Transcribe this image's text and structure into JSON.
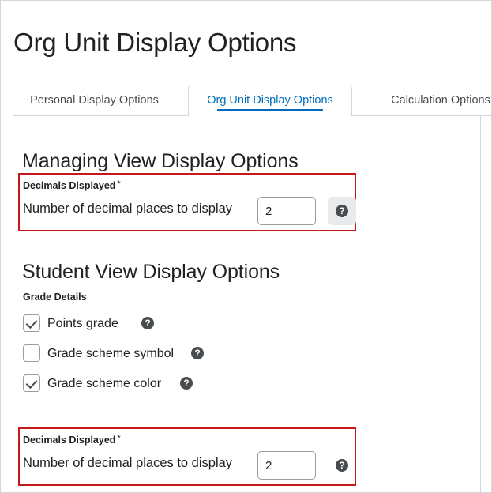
{
  "page": {
    "title": "Org Unit Display Options"
  },
  "tabs": [
    {
      "label": "Personal Display Options",
      "active": false
    },
    {
      "label": "Org Unit Display Options",
      "active": true
    },
    {
      "label": "Calculation Options",
      "active": false
    }
  ],
  "sections": {
    "managing_view": {
      "heading": "Managing View Display Options",
      "decimals": {
        "label": "Decimals Displayed",
        "required_marker": "*",
        "caption": "Number of decimal places to display",
        "value": "2",
        "help_icon": "help-circle-icon",
        "help_button_state": "hover"
      }
    },
    "student_view": {
      "heading": "Student View Display Options",
      "grade_details": {
        "subheading": "Grade Details",
        "options": [
          {
            "label": "Points grade",
            "checked": true,
            "help_icon": "help-circle-icon"
          },
          {
            "label": "Grade scheme symbol",
            "checked": false,
            "help_icon": "help-circle-icon"
          },
          {
            "label": "Grade scheme color",
            "checked": true,
            "help_icon": "help-circle-icon"
          }
        ]
      },
      "decimals": {
        "label": "Decimals Displayed",
        "required_marker": "*",
        "caption": "Number of decimal places to display",
        "value": "2",
        "help_icon": "help-circle-icon",
        "help_button_state": "default"
      }
    }
  },
  "colors": {
    "highlight_border": "#c6171a",
    "active_tab_text": "#006fbf",
    "active_tab_underline": "#0069bd",
    "text": "#202122",
    "panel_border": "#d3d6d8"
  }
}
